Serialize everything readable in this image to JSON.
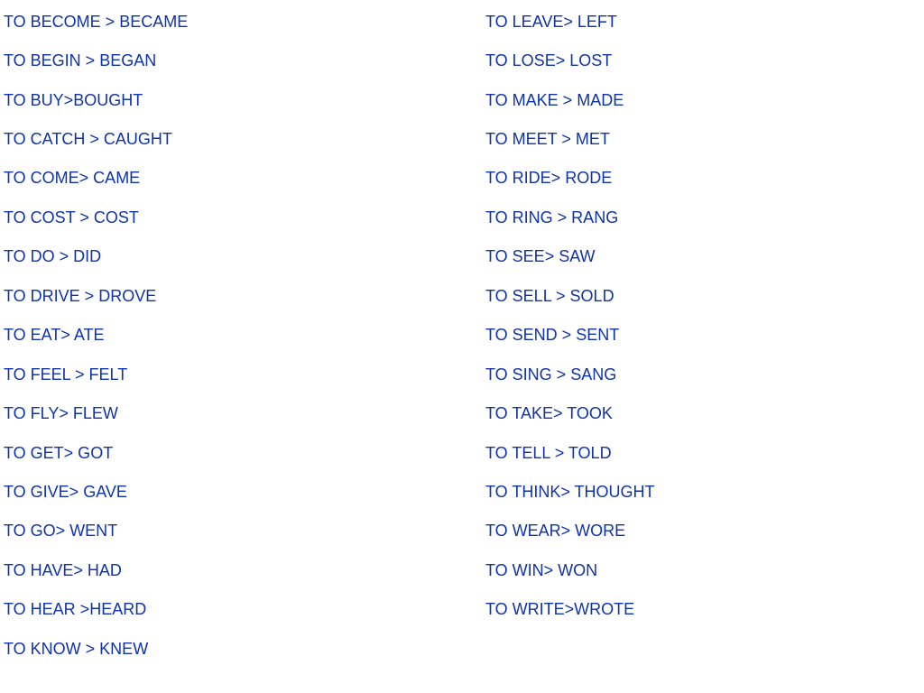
{
  "text_color": "#1033a8",
  "left_column": [
    "TO BECOME > BECAME",
    "TO BEGIN > BEGAN",
    "TO BUY>BOUGHT",
    "TO CATCH > CAUGHT",
    "TO COME> CAME",
    "TO COST > COST",
    "TO DO > DID",
    "TO DRIVE > DROVE",
    "TO EAT> ATE",
    "TO FEEL > FELT",
    "TO FLY> FLEW",
    "TO GET> GOT",
    "TO GIVE> GAVE",
    "TO GO> WENT",
    "TO HAVE> HAD",
    "TO HEAR >HEARD",
    "TO KNOW > KNEW"
  ],
  "right_column": [
    "TO LEAVE> LEFT",
    "TO LOSE> LOST",
    "TO MAKE > MADE",
    "TO MEET > MET",
    "TO RIDE> RODE",
    "TO RING > RANG",
    "TO SEE> SAW",
    "TO SELL > SOLD",
    "TO SEND > SENT",
    "TO SING > SANG",
    "TO TAKE> TOOK",
    "TO TELL > TOLD",
    "TO THINK> THOUGHT",
    "TO WEAR> WORE",
    "TO WIN> WON",
    "TO WRITE>WROTE"
  ]
}
